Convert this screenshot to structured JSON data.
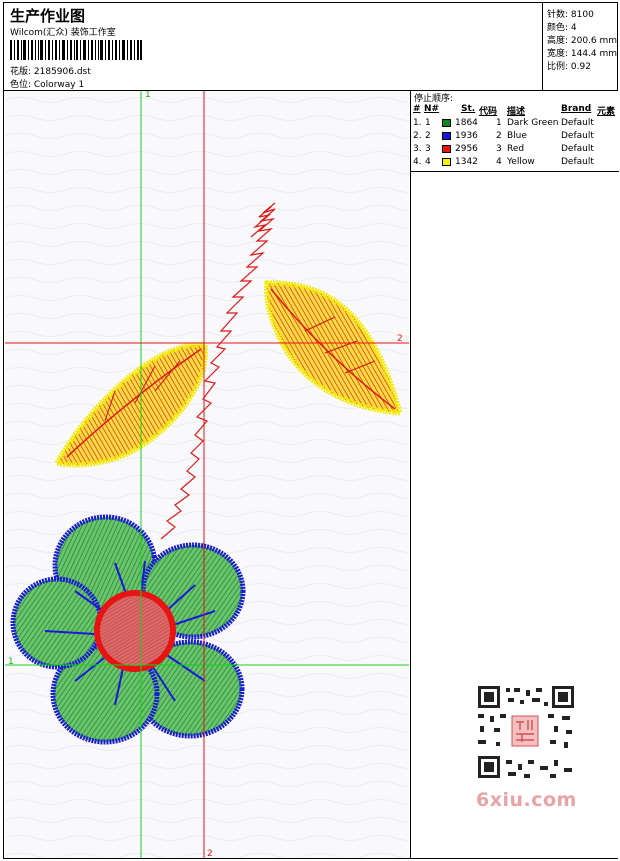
{
  "header": {
    "title": "生产作业图",
    "studio": "Wilcom(汇众) 装饰工作室",
    "design_line": "花版: 2185906.dst",
    "colorway_line": "色位: Colorway 1"
  },
  "stats": {
    "stitches": "针数: 8100",
    "colors": "颜色: 4",
    "height": "高度: 200.6 mm",
    "width": "宽度: 144.4 mm",
    "scale": "比例: 0.92"
  },
  "stop_sequence": {
    "title": "停止顺序:",
    "headers": [
      "#",
      "N#",
      "St.",
      "代码",
      "描述",
      "Brand",
      "元素"
    ],
    "rows": [
      {
        "num": "1.",
        "n": "1",
        "color": "#0e8a14",
        "stitches": "1864",
        "code": "1",
        "desc": "Dark Green",
        "brand": "Default"
      },
      {
        "num": "2.",
        "n": "2",
        "color": "#1616e0",
        "stitches": "1936",
        "code": "2",
        "desc": "Blue",
        "brand": "Default"
      },
      {
        "num": "3.",
        "n": "3",
        "color": "#e81414",
        "stitches": "2956",
        "code": "3",
        "desc": "Red",
        "brand": "Default"
      },
      {
        "num": "4.",
        "n": "4",
        "color": "#f4f000",
        "stitches": "1342",
        "code": "4",
        "desc": "Yellow",
        "brand": "Default"
      }
    ]
  },
  "guides": {
    "v1": "1",
    "h1": "1",
    "v2": "2",
    "h2": "2",
    "green": "#19d019",
    "red": "#e81414"
  },
  "thread_colors": {
    "green": "#2ea83a",
    "blue": "#1a1ad8",
    "red": "#e41414",
    "yellow": "#f6f000"
  },
  "watermark": "6xiu.com"
}
